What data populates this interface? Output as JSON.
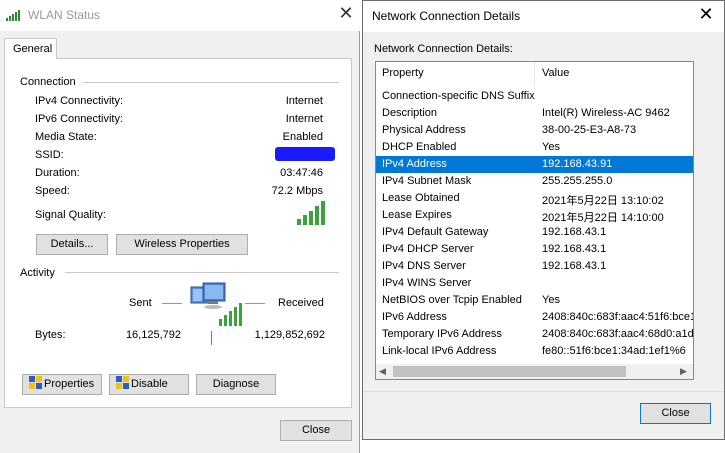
{
  "wlan": {
    "title": "WLAN Status",
    "tab": "General",
    "connection_label": "Connection",
    "rows": [
      {
        "label": "IPv4 Connectivity:",
        "value": "Internet"
      },
      {
        "label": "IPv6 Connectivity:",
        "value": "Internet"
      },
      {
        "label": "Media State:",
        "value": "Enabled"
      },
      {
        "label": "SSID:",
        "value": ""
      },
      {
        "label": "Duration:",
        "value": "03:47:46"
      },
      {
        "label": "Speed:",
        "value": "72.2 Mbps"
      }
    ],
    "signal_label": "Signal Quality:",
    "signal_bars": 5,
    "details_button": "Details...",
    "wireless_properties_button": "Wireless Properties",
    "activity_label": "Activity",
    "sent_label": "Sent",
    "received_label": "Received",
    "bytes_label": "Bytes:",
    "bytes_sent": "16,125,792",
    "bytes_received": "1,129,852,692",
    "properties_button": "Properties",
    "disable_button": "Disable",
    "diagnose_button": "Diagnose",
    "close_button": "Close",
    "ssid_redaction_color": "#1a1aff"
  },
  "details": {
    "title": "Network Connection Details",
    "subtitle": "Network Connection Details:",
    "col_property": "Property",
    "col_value": "Value",
    "selected_row": "IPv4 Address",
    "rows": [
      {
        "property": "Connection-specific DNS Suffix",
        "value": ""
      },
      {
        "property": "Description",
        "value": "Intel(R) Wireless-AC 9462"
      },
      {
        "property": "Physical Address",
        "value": "38-00-25-E3-A8-73"
      },
      {
        "property": "DHCP Enabled",
        "value": "Yes"
      },
      {
        "property": "IPv4 Address",
        "value": "192.168.43.91"
      },
      {
        "property": "IPv4 Subnet Mask",
        "value": "255.255.255.0"
      },
      {
        "property": "Lease Obtained",
        "value": "2021年5月22日 13:10:02"
      },
      {
        "property": "Lease Expires",
        "value": "2021年5月22日 14:10:00"
      },
      {
        "property": "IPv4 Default Gateway",
        "value": "192.168.43.1"
      },
      {
        "property": "IPv4 DHCP Server",
        "value": "192.168.43.1"
      },
      {
        "property": "IPv4 DNS Server",
        "value": "192.168.43.1"
      },
      {
        "property": "IPv4 WINS Server",
        "value": ""
      },
      {
        "property": "NetBIOS over Tcpip Enabled",
        "value": "Yes"
      },
      {
        "property": "IPv6 Address",
        "value": "2408:840c:683f:aac4:51f6:bce1"
      },
      {
        "property": "Temporary IPv6 Address",
        "value": "2408:840c:683f:aac4:68d0:a1d"
      },
      {
        "property": "Link-local IPv6 Address",
        "value": "fe80::51f6:bce1:34ad:1ef1%6"
      }
    ],
    "close_button": "Close",
    "accent_color": "#0078d7"
  }
}
